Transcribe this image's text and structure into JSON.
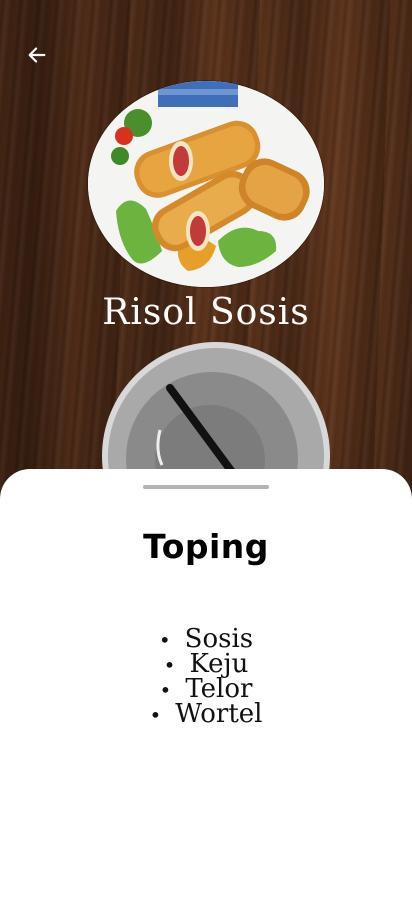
{
  "header": {
    "back_icon": "arrow-left-icon"
  },
  "hero": {
    "image": "risol-sosis-photo",
    "title": "Risol Sosis"
  },
  "sheet": {
    "title": "Toping",
    "toppings": [
      {
        "label": "Sosis"
      },
      {
        "label": "Keju"
      },
      {
        "label": "Telor"
      },
      {
        "label": "Wortel"
      }
    ],
    "bullet": "•"
  },
  "colors": {
    "sheet_background": "#ffffff",
    "title_text": "#ffffff",
    "handle": "#b3b3b3"
  }
}
